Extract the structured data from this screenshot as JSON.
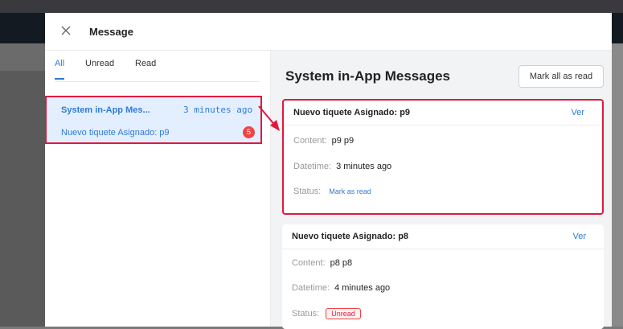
{
  "drawer": {
    "title": "Message"
  },
  "tabs": [
    {
      "label": "All"
    },
    {
      "label": "Unread"
    },
    {
      "label": "Read"
    }
  ],
  "list": {
    "item": {
      "title": "System in-App Mes...",
      "time": "3 minutes ago",
      "subject": "Nuevo tiquete Asignado: p9",
      "badge": "5"
    }
  },
  "main": {
    "title": "System in-App Messages",
    "mark_all_label": "Mark all as read",
    "cards": [
      {
        "title": "Nuevo tiquete Asignado: p9",
        "link": "Ver",
        "content_label": "Content:",
        "content": "p9 p9",
        "datetime_label": "Datetime:",
        "datetime": "3 minutes ago",
        "status_label": "Status:",
        "status_action": "Mark as read"
      },
      {
        "title": "Nuevo tiquete Asignado: p8",
        "link": "Ver",
        "content_label": "Content:",
        "content": "p8 p8",
        "datetime_label": "Datetime:",
        "datetime": "4 minutes ago",
        "status_label": "Status:",
        "status_tag": "Unread"
      }
    ]
  },
  "colors": {
    "accent": "#2f7bd8",
    "highlight": "#e0183f",
    "badge": "#ef4444"
  },
  "icons": {
    "close": "close-icon",
    "arrow": "red-arrow-annotation"
  }
}
